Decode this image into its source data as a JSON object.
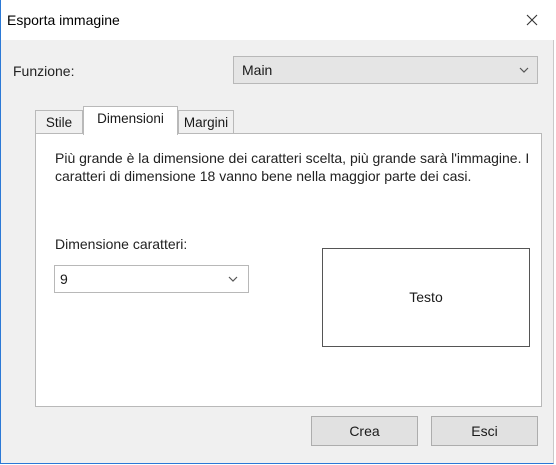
{
  "window": {
    "title": "Esporta immagine"
  },
  "function": {
    "label": "Funzione:",
    "selected": "Main"
  },
  "tabs": [
    {
      "label": "Stile",
      "active": false
    },
    {
      "label": "Dimensioni",
      "active": true
    },
    {
      "label": "Margini",
      "active": false
    }
  ],
  "panel": {
    "description": "Più grande è la dimensione dei caratteri scelta, più grande sarà l'immagine. I caratteri di dimensione 18 vanno bene nella maggior parte dei casi.",
    "font_size_label": "Dimensione caratteri:",
    "font_size_value": "9",
    "preview_text": "Testo"
  },
  "buttons": {
    "create": "Crea",
    "exit": "Esci"
  },
  "icons": {
    "close": "close-icon",
    "dropdown": "chevron-down-icon"
  },
  "colors": {
    "window_border": "#2b79d6",
    "dialog_bg": "#f0f0f0",
    "combo_bg": "#e5e5e5"
  }
}
